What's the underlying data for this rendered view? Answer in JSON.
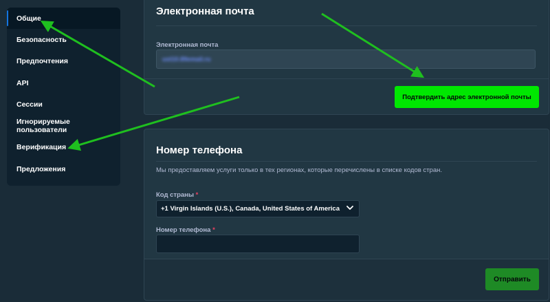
{
  "sidebar": {
    "items": [
      {
        "label": "Общие"
      },
      {
        "label": "Безопасность"
      },
      {
        "label": "Предпочтения"
      },
      {
        "label": "API"
      },
      {
        "label": "Сессии"
      },
      {
        "label": "Игнорируемые пользователи"
      },
      {
        "label": "Верификация"
      },
      {
        "label": "Предложения"
      }
    ]
  },
  "email_section": {
    "title": "Электронная почта",
    "field_label": "Электронная почта",
    "field_value": "ust10.89email.ru",
    "confirm_button": "Подтвердить адрес электронной почты"
  },
  "phone_section": {
    "title": "Номер телефона",
    "description": "Мы предоставляем услуги только в тех регионах, которые перечислены в списке кодов стран.",
    "country_label": "Код страны",
    "country_value": "+1 Virgin Islands (U.S.), Canada, United States of America",
    "phone_label": "Номер телефона",
    "required_mark": "*",
    "send_button": "Отправить"
  },
  "colors": {
    "accent_green": "#00e701",
    "annotation_arrow": "#1fbf1f",
    "active_indicator": "#1475e1"
  }
}
